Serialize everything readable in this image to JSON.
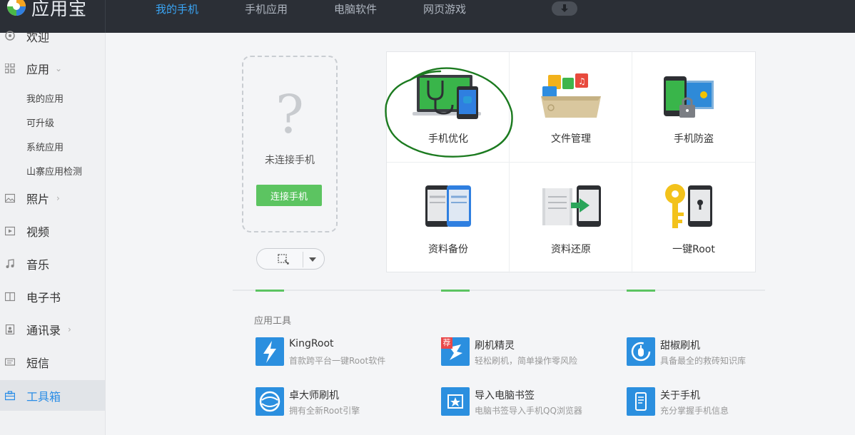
{
  "app": {
    "title": "应用宝"
  },
  "nav": [
    {
      "label": "我的手机",
      "active": true
    },
    {
      "label": "手机应用",
      "active": false
    },
    {
      "label": "电脑软件",
      "active": false
    },
    {
      "label": "网页游戏",
      "active": false
    }
  ],
  "sidebar": {
    "items": [
      {
        "label": "欢迎",
        "icon": "welcome-icon"
      },
      {
        "label": "应用",
        "icon": "grid-icon",
        "expanded": true
      },
      {
        "label": "照片",
        "icon": "photo-icon"
      },
      {
        "label": "视频",
        "icon": "video-icon"
      },
      {
        "label": "音乐",
        "icon": "music-icon"
      },
      {
        "label": "电子书",
        "icon": "book-icon"
      },
      {
        "label": "通讯录",
        "icon": "contacts-icon"
      },
      {
        "label": "短信",
        "icon": "sms-icon"
      },
      {
        "label": "工具箱",
        "icon": "toolbox-icon",
        "selected": true
      }
    ],
    "sub_items": [
      "我的应用",
      "可升级",
      "系统应用",
      "山寨应用检测"
    ]
  },
  "phone": {
    "placeholder": "?",
    "status": "未连接手机",
    "connect_label": "连接手机"
  },
  "features": [
    {
      "label": "手机优化",
      "icon": "phone-optimize-icon"
    },
    {
      "label": "文件管理",
      "icon": "file-manager-icon"
    },
    {
      "label": "手机防盗",
      "icon": "anti-theft-icon"
    },
    {
      "label": "资料备份",
      "icon": "backup-icon"
    },
    {
      "label": "资料还原",
      "icon": "restore-icon"
    },
    {
      "label": "一键Root",
      "icon": "root-key-icon"
    }
  ],
  "tools_section": {
    "title": "应用工具",
    "tools": [
      {
        "name": "KingRoot",
        "desc": "首款跨平台一键Root软件",
        "icon": "lightning-icon",
        "color": "#2b8fdf"
      },
      {
        "name": "刷机精灵",
        "desc": "轻松刷机，简单操作零风险",
        "icon": "flash-sprite-icon",
        "color": "#2b8fdf",
        "badge": "荐"
      },
      {
        "name": "甜椒刷机",
        "desc": "具备最全的救砖知识库",
        "icon": "pepper-icon",
        "color": "#2b8fdf"
      },
      {
        "name": "卓大师刷机",
        "desc": "拥有全新Root引擎",
        "icon": "globe-icon",
        "color": "#2b8fdf"
      },
      {
        "name": "导入电脑书签",
        "desc": "电脑书签导入手机QQ浏览器",
        "icon": "bookmark-icon",
        "color": "#2b8fdf"
      },
      {
        "name": "关于手机",
        "desc": "充分掌握手机信息",
        "icon": "phone-info-icon",
        "color": "#2b8fdf"
      }
    ]
  },
  "colors": {
    "topbar": "#2b2f36",
    "nav_active": "#3aa5f5",
    "accent_green": "#5cc461",
    "tool_blue": "#2b8fdf",
    "annotation": "#1b7a1f"
  }
}
